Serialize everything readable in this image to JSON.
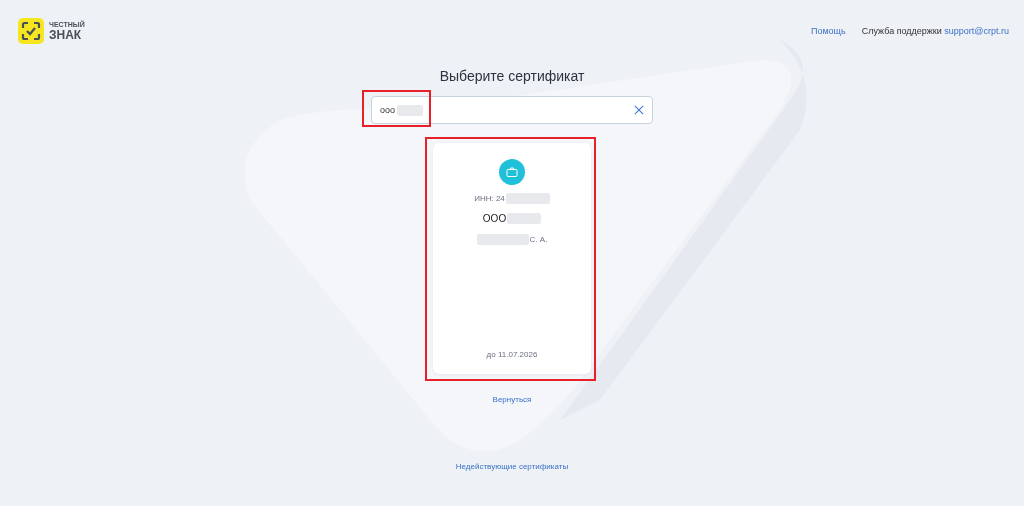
{
  "logo": {
    "line1": "ЧЕСТНЫЙ",
    "line2": "ЗНАК"
  },
  "header": {
    "help_link": "Помощь",
    "support_label": "Служба поддержки",
    "support_email": "support@crpt.ru"
  },
  "title": "Выберите сертификат",
  "search": {
    "value": "ооо",
    "redacted": true,
    "highlighted": true
  },
  "certificates": [
    {
      "inn": "ИНН: 24",
      "org": "ООО",
      "person": "С. А.",
      "valid_until": "до 11.07.2026",
      "redacted": true,
      "highlighted": true
    }
  ],
  "back_link": "Вернуться",
  "invalid_link": "Недействующие сертификаты"
}
